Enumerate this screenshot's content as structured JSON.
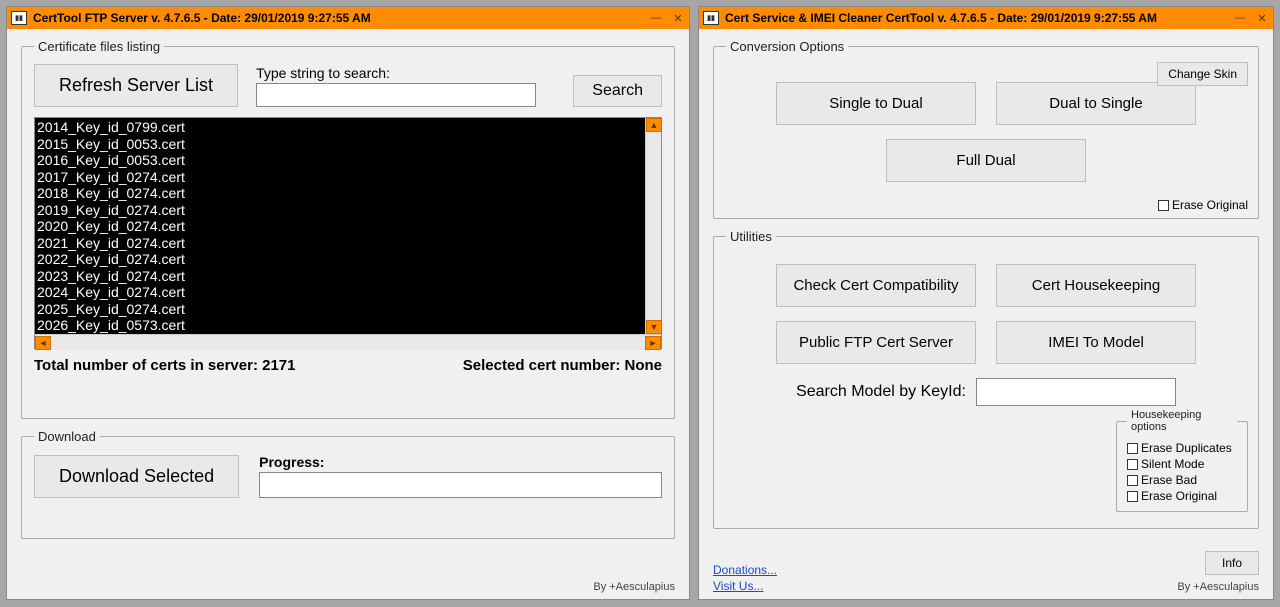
{
  "win1": {
    "title": "CertTool FTP Server v. 4.7.6.5 - Date: 29/01/2019 9:27:55 AM",
    "group_listing": "Certificate files listing",
    "refresh_btn": "Refresh Server List",
    "search_label": "Type string to search:",
    "search_btn": "Search",
    "search_value": "",
    "items": [
      "2014_Key_id_0799.cert",
      "2015_Key_id_0053.cert",
      "2016_Key_id_0053.cert",
      "2017_Key_id_0274.cert",
      "2018_Key_id_0274.cert",
      "2019_Key_id_0274.cert",
      "2020_Key_id_0274.cert",
      "2021_Key_id_0274.cert",
      "2022_Key_id_0274.cert",
      "2023_Key_id_0274.cert",
      "2024_Key_id_0274.cert",
      "2025_Key_id_0274.cert",
      "2026_Key_id_0573.cert"
    ],
    "total_label": "Total number of certs in server: 2171",
    "selected_label": "Selected cert number: None",
    "group_download": "Download",
    "download_btn": "Download Selected",
    "progress_label": "Progress:",
    "credit": "By +Aesculapius"
  },
  "win2": {
    "title": "Cert Service & IMEI Cleaner CertTool v. 4.7.6.5 - Date: 29/01/2019 9:27:55 AM",
    "group_conv": "Conversion Options",
    "change_skin": "Change Skin",
    "single_to_dual": "Single to Dual",
    "dual_to_single": "Dual to Single",
    "full_dual": "Full Dual",
    "erase_original": "Erase Original",
    "group_util": "Utilities",
    "check_compat": "Check Cert Compatibility",
    "housekeeping": "Cert Housekeeping",
    "public_ftp": "Public FTP Cert Server",
    "imei_to_model": "IMEI To Model",
    "search_model_label": "Search Model by KeyId:",
    "search_model_value": "",
    "hk_legend": "Housekeeping options",
    "hk_dup": "Erase Duplicates",
    "hk_silent": "Silent Mode",
    "hk_bad": "Erase Bad",
    "hk_orig": "Erase Original",
    "donations": "Donations...",
    "visit": "Visit Us...",
    "info": "Info",
    "credit": "By +Aesculapius"
  }
}
